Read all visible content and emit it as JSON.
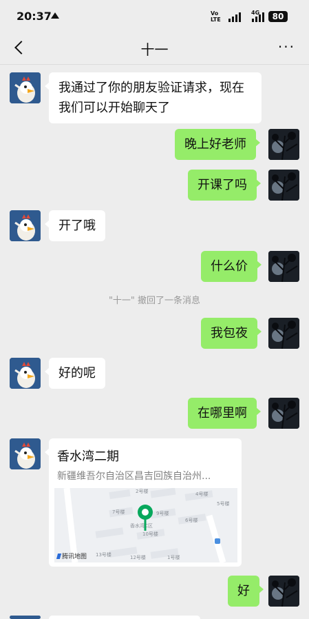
{
  "status_bar": {
    "time": "20:37",
    "volte_line1": "Vo",
    "volte_line2": "LTE",
    "network": "4G",
    "battery": "80"
  },
  "header": {
    "title": "十一"
  },
  "messages": [
    {
      "side": "left",
      "text": "我通过了你的朋友验证请求，现在我们可以开始聊天了"
    },
    {
      "side": "right",
      "text": "晚上好老师"
    },
    {
      "side": "right",
      "text": "开课了吗"
    },
    {
      "side": "left",
      "text": "开了哦"
    },
    {
      "side": "right",
      "text": "什么价"
    },
    {
      "side": "system",
      "text": "\"十一\" 撤回了一条消息"
    },
    {
      "side": "right",
      "text": "我包夜"
    },
    {
      "side": "left",
      "text": "好的呢"
    },
    {
      "side": "right",
      "text": "在哪里啊"
    },
    {
      "side": "right",
      "text": "好"
    }
  ],
  "location": {
    "name": "香水湾二期",
    "address": "新疆维吾尔自治区昌吉回族自治州...",
    "map_brand": "腾讯地图",
    "map_labels": [
      "2号楼",
      "4号楼",
      "5号楼",
      "7号楼",
      "9号楼",
      "6号楼",
      "香水湾C区",
      "10号楼",
      "13号楼",
      "12号楼",
      "1号楼"
    ],
    "pin_color": "#07a85c"
  },
  "colors": {
    "background": "#ededed",
    "bubble_self": "#95ec69",
    "bubble_other": "#ffffff"
  },
  "icons": [
    "back-arrow-icon",
    "more-icon",
    "signal-icon",
    "battery-icon",
    "location-pin-icon"
  ]
}
